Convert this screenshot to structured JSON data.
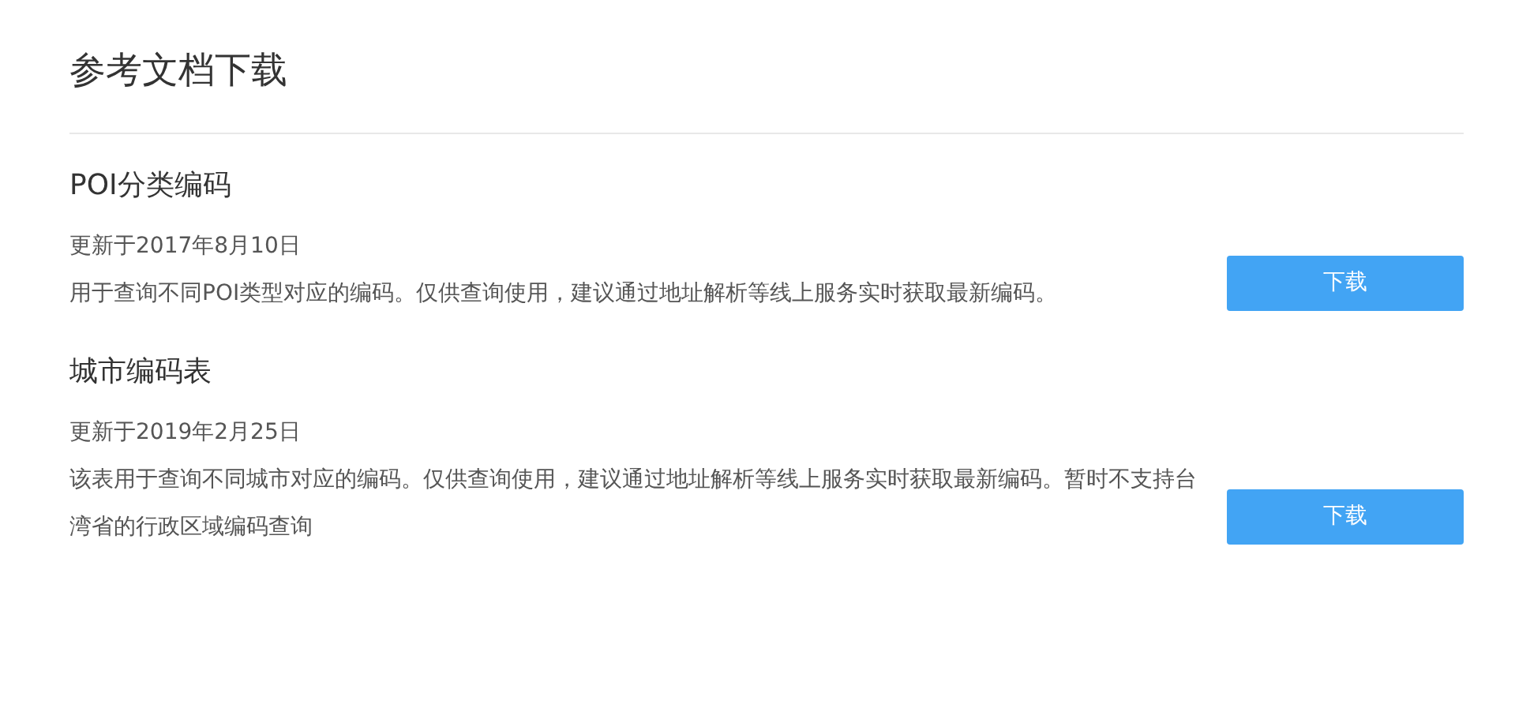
{
  "title": "参考文档下载",
  "documents": [
    {
      "name": "POI分类编码",
      "date": "更新于2017年8月10日",
      "description": "用于查询不同POI类型对应的编码。仅供查询使用，建议通过地址解析等线上服务实时获取最新编码。",
      "button": "下载"
    },
    {
      "name": "城市编码表",
      "date": "更新于2019年2月25日",
      "description": "该表用于查询不同城市对应的编码。仅供查询使用，建议通过地址解析等线上服务实时获取最新编码。暂时不支持台湾省的行政区域编码查询",
      "button": "下载"
    }
  ]
}
